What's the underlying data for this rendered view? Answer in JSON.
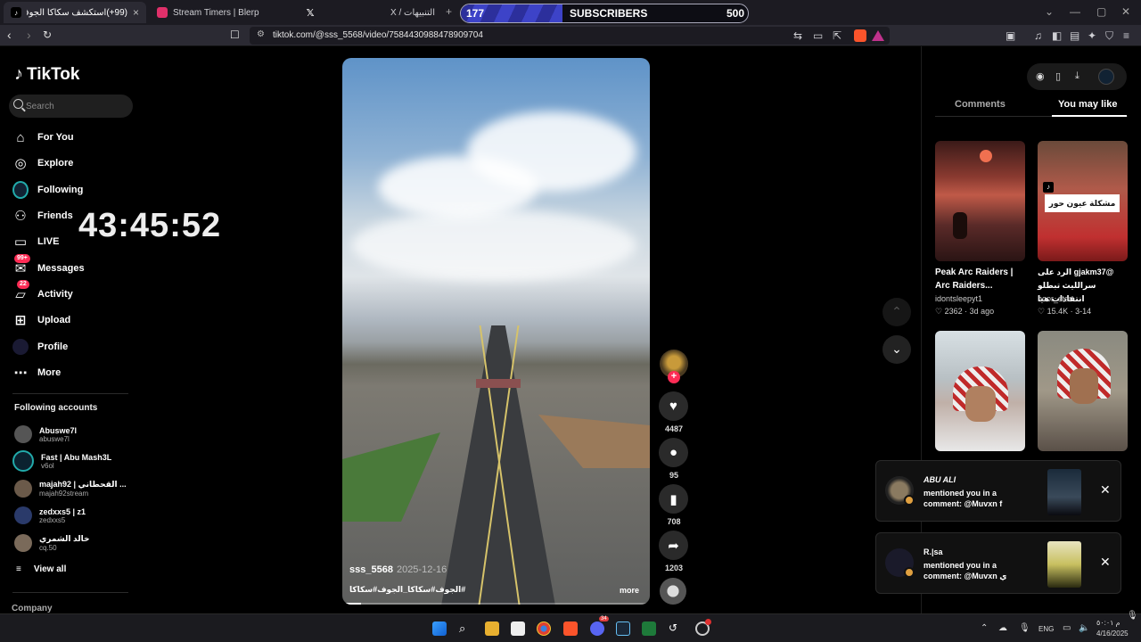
{
  "browser": {
    "tabs": [
      {
        "title": "(99+)استكشف سكاكا الجوف جمال",
        "active": true
      },
      {
        "title": "Stream Timers | Blerp",
        "active": false
      },
      {
        "title": "X / التنبيهات",
        "active": false
      }
    ],
    "url": "tiktok.com/@sss_5568/video/7584430988478909704"
  },
  "overlay": {
    "subscriber_current": "177",
    "subscriber_label": "SUBSCRIBERS",
    "subscriber_goal": "500",
    "subscriber_progress": 0.354,
    "timer": "43:45:52"
  },
  "sidebar": {
    "logo": "TikTok",
    "search_placeholder": "Search",
    "menu": [
      {
        "label": "For You",
        "icon": "home-icon"
      },
      {
        "label": "Explore",
        "icon": "compass-icon"
      },
      {
        "label": "Following",
        "icon": "following-avatar-icon"
      },
      {
        "label": "Friends",
        "icon": "friends-icon"
      },
      {
        "label": "LIVE",
        "icon": "live-icon"
      },
      {
        "label": "Messages",
        "icon": "messages-icon",
        "badge": "99+"
      },
      {
        "label": "Activity",
        "icon": "activity-icon",
        "badge": "22"
      },
      {
        "label": "Upload",
        "icon": "upload-icon"
      },
      {
        "label": "Profile",
        "icon": "profile-avatar-icon"
      },
      {
        "label": "More",
        "icon": "more-icon"
      }
    ],
    "following_title": "Following accounts",
    "accounts": [
      {
        "name": "Abuswe7l",
        "handle": "abuswe7l"
      },
      {
        "name": "Fast | Abu Mash3L",
        "handle": "v6ol"
      },
      {
        "name": "majah92 | القحطاني ...",
        "handle": "majah92stream"
      },
      {
        "name": "zedxxs5 | z1",
        "handle": "zedxxs5"
      },
      {
        "name": "خالد الشمري",
        "handle": "cq.50"
      }
    ],
    "view_all": "View all",
    "company": "Company"
  },
  "video": {
    "username": "sss_5568",
    "date": "2025-12-16",
    "hashtags": "#الجوف#سكاكا_الجوف#سكاكا",
    "more": "more",
    "likes": "4487",
    "comments": "95",
    "saves": "708",
    "shares": "1203"
  },
  "right_panel": {
    "tab_comments": "Comments",
    "tab_you_may_like": "You may like",
    "cards": [
      {
        "title": "Peak Arc Raiders | Arc Raiders...",
        "user": "idontsleepyt1",
        "likes": "2362",
        "age": "3d ago"
      },
      {
        "title": "@gjakm37 الرد على سرالليث تبطلو انتقادات هيا",
        "user": "hoor_star",
        "likes": "15.4K",
        "age": "3-14",
        "thumb_label": "مشكلة عيون حور"
      }
    ]
  },
  "notifications": [
    {
      "name": "ABU ALI",
      "message": "mentioned you in a comment: @Muvxn f"
    },
    {
      "name": "R.|sa",
      "message": "mentioned you in a comment: @Muvxn ي"
    }
  ],
  "taskbar": {
    "lang": "ENG",
    "time": "م ٥٠:٠١",
    "date": "4/16/2025",
    "discord_badge": "34"
  },
  "colors": {
    "accent": "#fe2c55",
    "subscriber_fill": "#3d43c8",
    "background": "#000000"
  }
}
